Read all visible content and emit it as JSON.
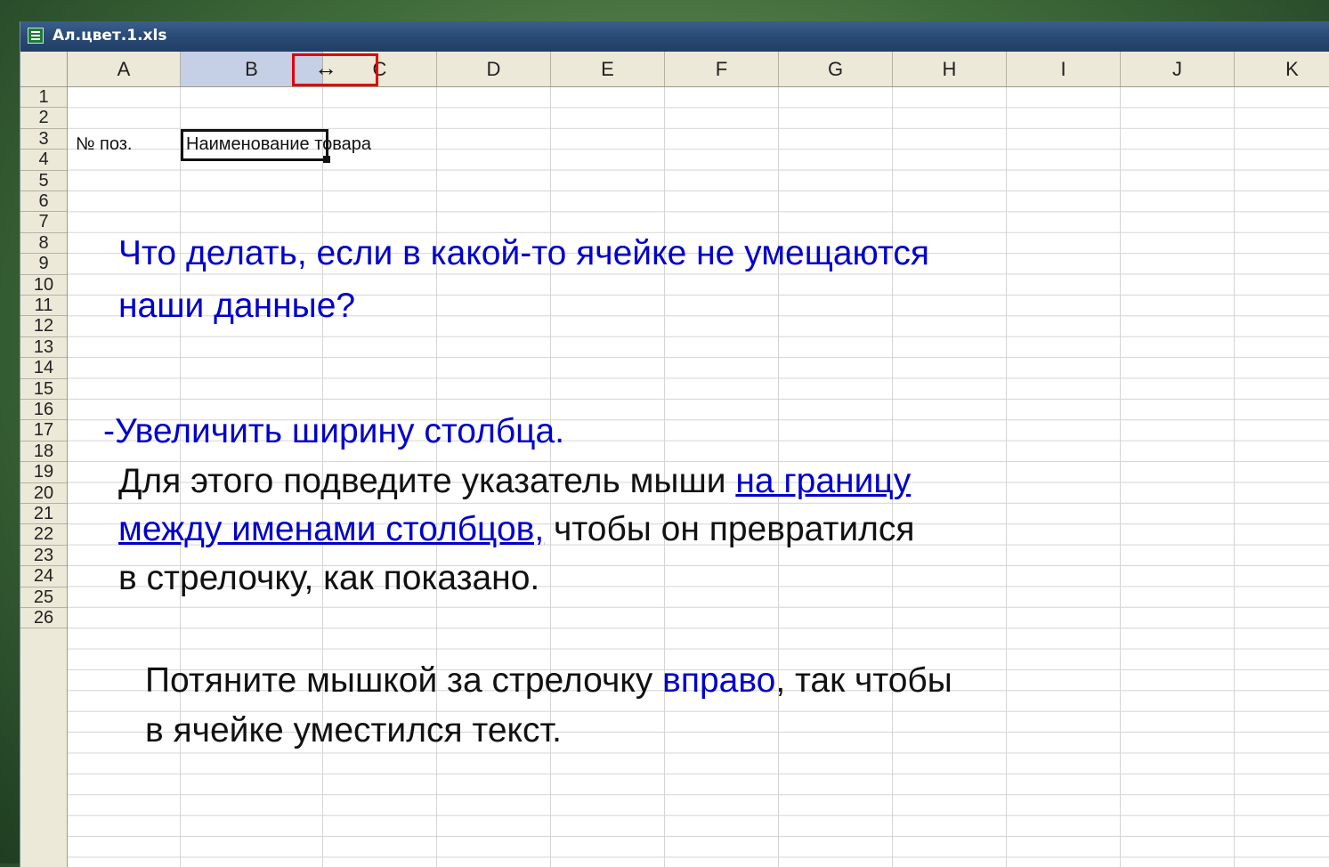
{
  "window": {
    "title": "Ал.цвет.1.xls",
    "icon": "excel-file-icon"
  },
  "columns": [
    "A",
    "B",
    "C",
    "D",
    "E",
    "F",
    "G",
    "H",
    "I",
    "J",
    "K"
  ],
  "selected_column": "B",
  "rows": [
    "1",
    "2",
    "3",
    "4",
    "5",
    "6",
    "7",
    "8",
    "9",
    "10",
    "11",
    "12",
    "13",
    "14",
    "15",
    "16",
    "17",
    "18",
    "19",
    "20",
    "21",
    "22",
    "23",
    "24",
    "25",
    "26"
  ],
  "cells": {
    "a3": "№ поз.",
    "b3": "Наименование товара"
  },
  "cursor": {
    "glyph": "↔",
    "name": "column-resize-cursor"
  },
  "overlay": {
    "question_line1": "Что делать, если в какой-то ячейке не умещаются",
    "question_line2": "наши данные?",
    "answer": "-Увеличить ширину столбца.",
    "instr_line1_a": "Для этого подведите указатель мыши ",
    "instr_line1_link": "на границу",
    "instr_line2_link": "между именами столбцов,",
    "instr_line2_b": " чтобы он превратился",
    "instr_line3": "в стрелочку, как показано.",
    "pull_a": "Потяните мышкой за стрелочку ",
    "pull_highlight": "вправо",
    "pull_b": ", так чтобы",
    "pull_line2": "в ячейке уместился текст."
  },
  "colors": {
    "question": "#0000cc",
    "link": "#0000cc",
    "highlight": "#0000cc",
    "body_text": "#111111",
    "cursor_box": "#e00000"
  }
}
